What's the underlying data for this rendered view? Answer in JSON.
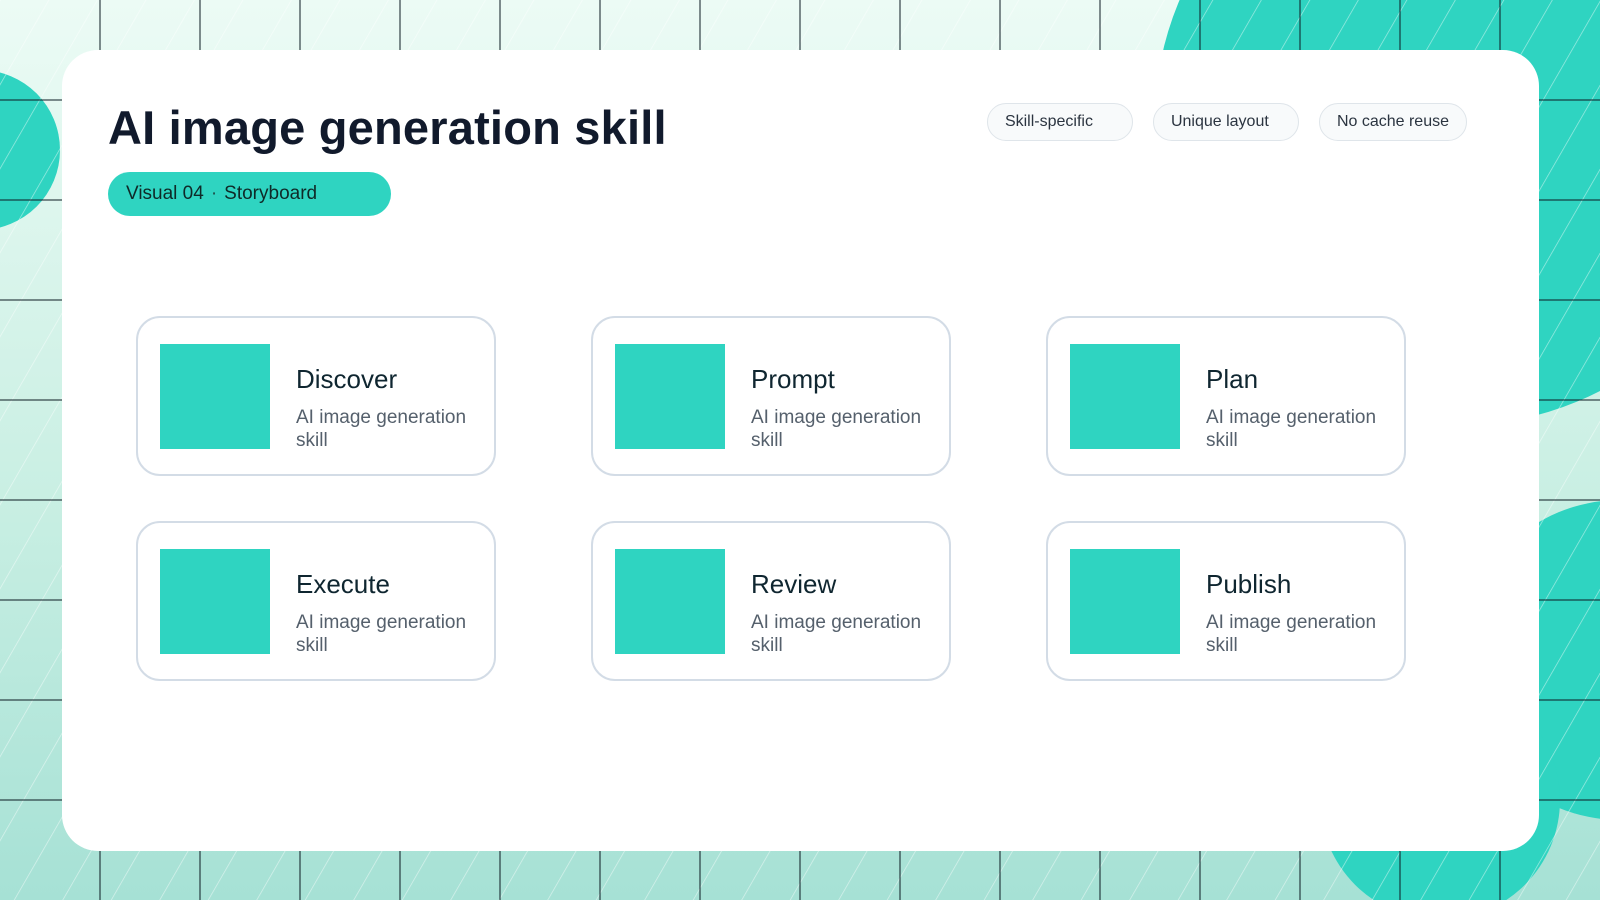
{
  "header": {
    "title": "AI image generation skill",
    "badge": {
      "label": "Visual 04",
      "separator": "·",
      "subtitle": "Storyboard"
    },
    "tags": [
      "Skill-specific",
      "Unique layout",
      "No cache reuse"
    ]
  },
  "steps": [
    {
      "title": "Discover",
      "description": "AI image generation skill"
    },
    {
      "title": "Prompt",
      "description": "AI image generation skill"
    },
    {
      "title": "Plan",
      "description": "AI image generation skill"
    },
    {
      "title": "Execute",
      "description": "AI image generation skill"
    },
    {
      "title": "Review",
      "description": "AI image generation skill"
    },
    {
      "title": "Publish",
      "description": "AI image generation skill"
    }
  ],
  "colors": {
    "accent": "#2fd4c1",
    "title_text": "#111a2c",
    "body_text": "#55606c",
    "card_border": "#d3dce6"
  }
}
